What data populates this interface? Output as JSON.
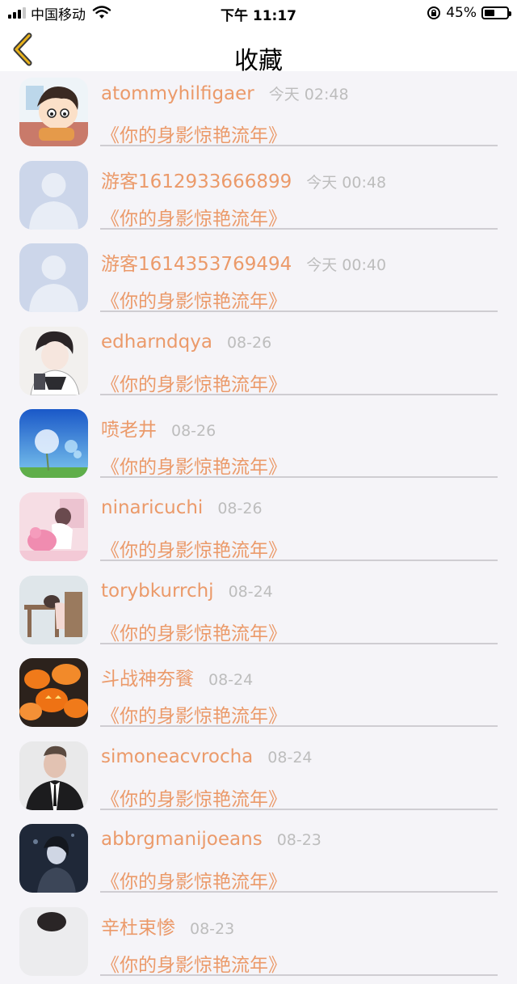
{
  "status_bar": {
    "carrier": "中国移动",
    "time": "下午 11:17",
    "battery_percent": "45%",
    "battery_level": 0.45
  },
  "nav": {
    "title": "收藏",
    "back_icon": "chevron-left-icon",
    "accent": "#e8b21c"
  },
  "colors": {
    "name": "#eb9a6a",
    "time": "#bdbdbd",
    "divider": "#cfcdd2",
    "background": "#f5f4f8"
  },
  "items": [
    {
      "name": "atommyhilfigaer",
      "time": "今天 02:48",
      "subtitle": "《你的身影惊艳流年》",
      "avatar": "cartoon-boy-avatar"
    },
    {
      "name": "游客1612933666899",
      "time": "今天 00:48",
      "subtitle": "《你的身影惊艳流年》",
      "avatar": "default-person-avatar"
    },
    {
      "name": "游客1614353769494",
      "time": "今天 00:40",
      "subtitle": "《你的身影惊艳流年》",
      "avatar": "default-person-avatar"
    },
    {
      "name": "edharndqya",
      "time": "08-26",
      "subtitle": "《你的身影惊艳流年》",
      "avatar": "anime-boy-avatar"
    },
    {
      "name": "喷老井",
      "time": "08-26",
      "subtitle": "《你的身影惊艳流年》",
      "avatar": "dandelion-sky-avatar"
    },
    {
      "name": "ninaricuchi",
      "time": "08-26",
      "subtitle": "《你的身影惊艳流年》",
      "avatar": "pink-girl-avatar"
    },
    {
      "name": "torybkurrchj",
      "time": "08-24",
      "subtitle": "《你的身影惊艳流年》",
      "avatar": "girl-desk-avatar"
    },
    {
      "name": "斗战神夯餮",
      "time": "08-24",
      "subtitle": "《你的身影惊艳流年》",
      "avatar": "pumpkins-avatar"
    },
    {
      "name": "simoneacvrocha",
      "time": "08-24",
      "subtitle": "《你的身影惊艳流年》",
      "avatar": "man-suit-avatar"
    },
    {
      "name": "abbrgmanijoeans",
      "time": "08-23",
      "subtitle": "《你的身影惊艳流年》",
      "avatar": "dark-portrait-avatar"
    },
    {
      "name": "辛杜束惨",
      "time": "08-23",
      "subtitle": "《你的身影惊艳流年》",
      "avatar": "partial-avatar"
    }
  ]
}
